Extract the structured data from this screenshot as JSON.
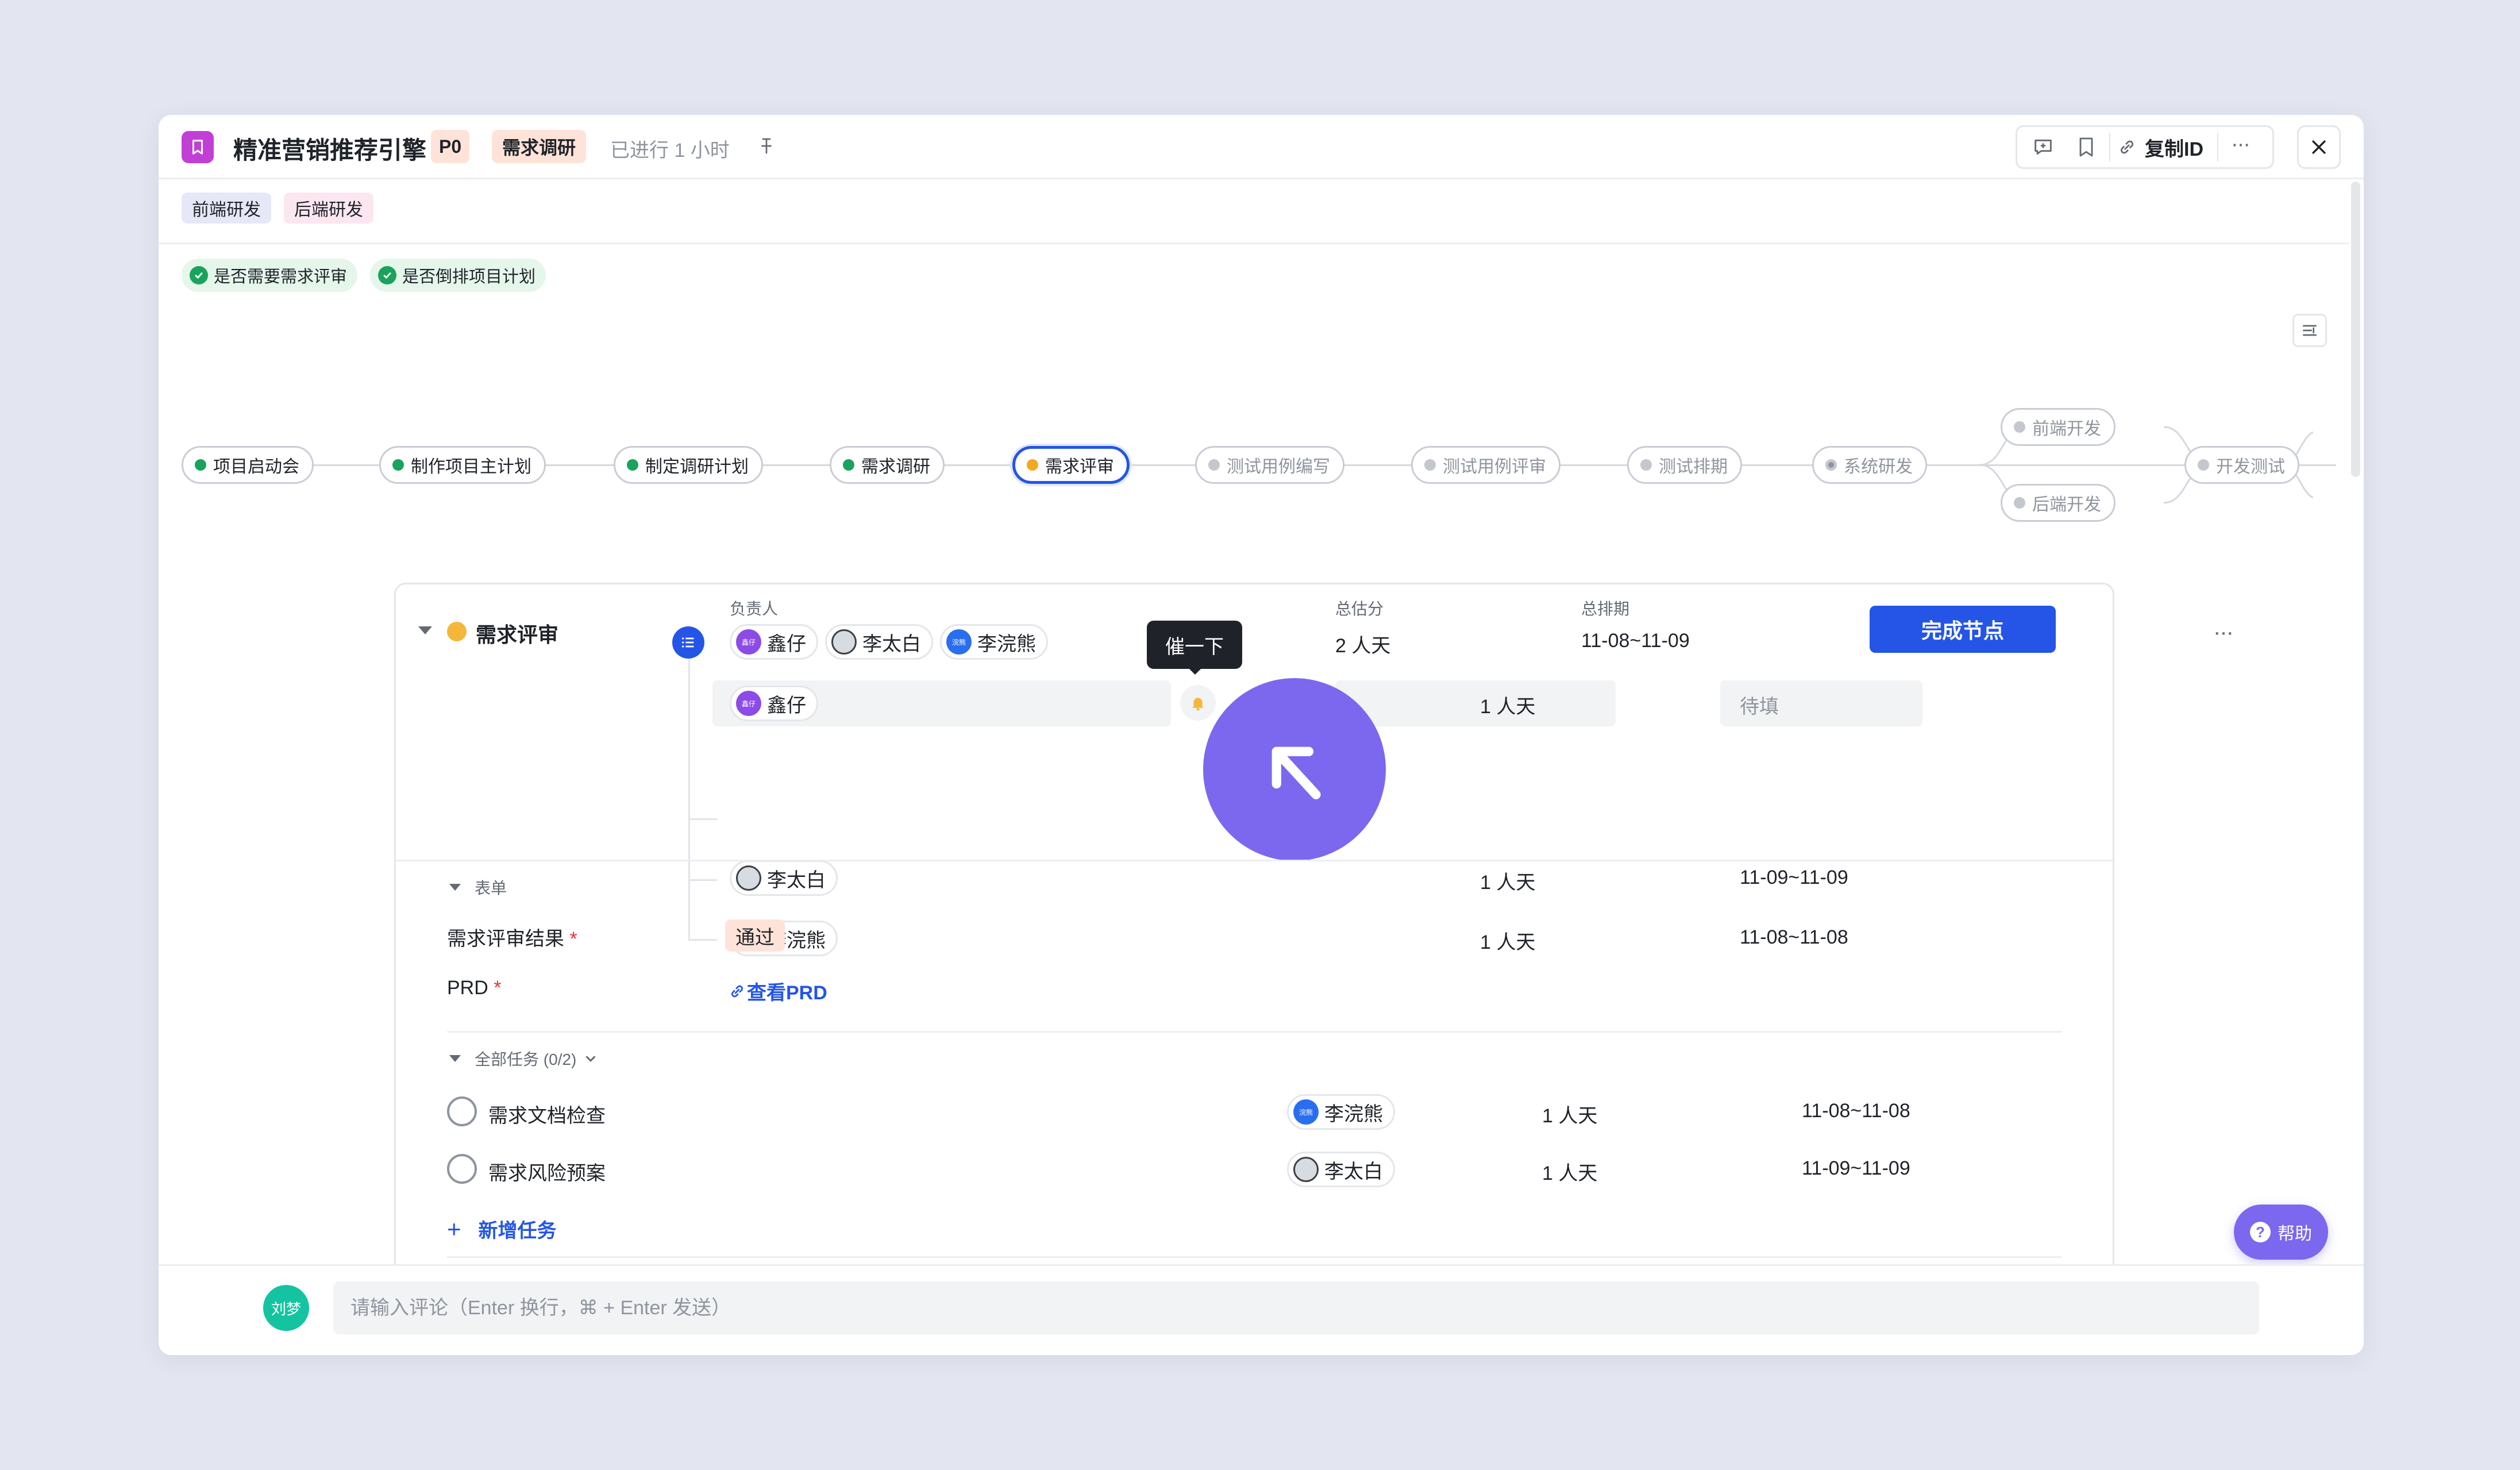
{
  "header": {
    "title": "精准营销推荐引擎",
    "priority": "P0",
    "stage": "需求调研",
    "elapsed": "已进行 1 小时",
    "copy_id_label": "复制ID"
  },
  "tags": [
    "前端研发",
    "后端研发"
  ],
  "checks": [
    "是否需要需求评审",
    "是否倒排项目计划"
  ],
  "flow": {
    "nodes": [
      "项目启动会",
      "制作项目主计划",
      "制定调研计划",
      "需求调研",
      "需求评审",
      "测试用例编写",
      "测试用例评审",
      "测试排期",
      "系统研发",
      "前端开发",
      "后端开发",
      "开发测试"
    ]
  },
  "detail": {
    "node_name": "需求评审",
    "owner_label": "负责人",
    "estimate_label": "总估分",
    "schedule_label": "总排期",
    "complete_button": "完成节点",
    "owners": [
      "鑫仔",
      "李太白",
      "李浣熊"
    ],
    "total_estimate": "2 人天",
    "total_schedule": "11-08~11-09",
    "tooltip": "催一下",
    "rows": [
      {
        "name": "鑫仔",
        "estimate": "1 人天",
        "schedule": "待填"
      },
      {
        "name": "李太白",
        "estimate": "1 人天",
        "schedule": "11-09~11-09"
      },
      {
        "name": "李浣熊",
        "estimate": "1 人天",
        "schedule": "11-08~11-08"
      }
    ],
    "form": {
      "section_label": "表单",
      "field1_label": "需求评审结果",
      "field1_value": "通过",
      "field2_label": "PRD",
      "field2_value": "查看PRD",
      "required_mark": "*"
    },
    "tasks": {
      "section_label": "全部任务 (0/2)",
      "items": [
        {
          "name": "需求文档检查",
          "owner": "李浣熊",
          "estimate": "1 人天",
          "schedule": "11-08~11-08"
        },
        {
          "name": "需求风险预案",
          "owner": "李太白",
          "estimate": "1 人天",
          "schedule": "11-09~11-09"
        }
      ],
      "add_label": "新增任务"
    }
  },
  "help_label": "帮助",
  "comment": {
    "avatar_text": "刘梦",
    "placeholder": "请输入评论（Enter 换行，⌘ + Enter 发送）"
  },
  "avatar_tiny": {
    "xinzai": "鑫仔",
    "lhx": "浣熊"
  },
  "colors": {
    "primary": "#2455e6",
    "success": "#1aa35c",
    "warning": "#f5a623",
    "cursor": "#7b68ee"
  }
}
